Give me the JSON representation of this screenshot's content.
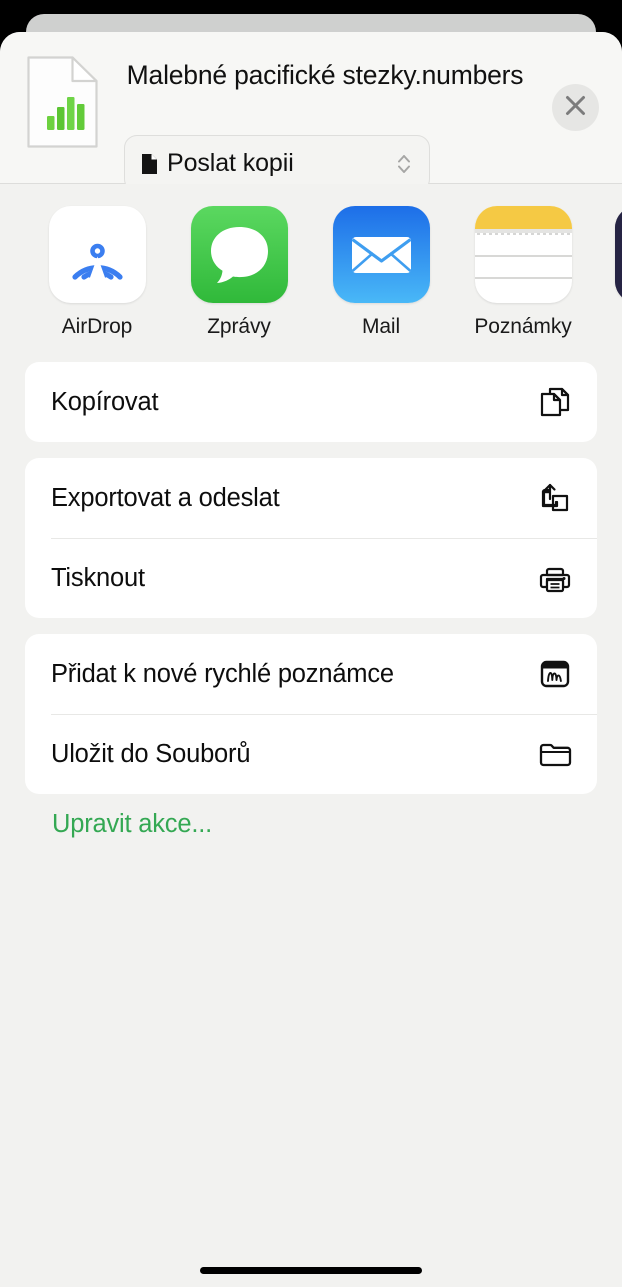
{
  "sheet": {
    "title": "Malebné pacifické stezky.numbers",
    "format_button": {
      "label": "Poslat kopii",
      "icon": "document-filled-icon",
      "stepper_icon": "chevron-up-down-icon"
    },
    "close_icon": "close-icon",
    "document_icon": "numbers-document-icon",
    "accent_color": "#34a853"
  },
  "apps": [
    {
      "label": "AirDrop",
      "icon": "airdrop-icon"
    },
    {
      "label": "Zprávy",
      "icon": "messages-icon"
    },
    {
      "label": "Mail",
      "icon": "mail-icon"
    },
    {
      "label": "Poznámky",
      "icon": "notes-icon"
    },
    {
      "label": "",
      "icon": "podcasts-icon"
    }
  ],
  "action_groups": [
    {
      "rows": [
        {
          "label": "Kopírovat",
          "icon": "copy-icon"
        }
      ]
    },
    {
      "rows": [
        {
          "label": "Exportovat a odeslat",
          "icon": "export-share-icon"
        },
        {
          "label": "Tisknout",
          "icon": "printer-icon"
        }
      ]
    },
    {
      "rows": [
        {
          "label": "Přidat k nové rychlé poznámce",
          "icon": "quick-note-icon"
        },
        {
          "label": "Uložit do Souborů",
          "icon": "folder-icon"
        }
      ]
    }
  ],
  "edit_actions": {
    "label": "Upravit akce..."
  },
  "home_indicator": {
    "name": "home-indicator"
  }
}
